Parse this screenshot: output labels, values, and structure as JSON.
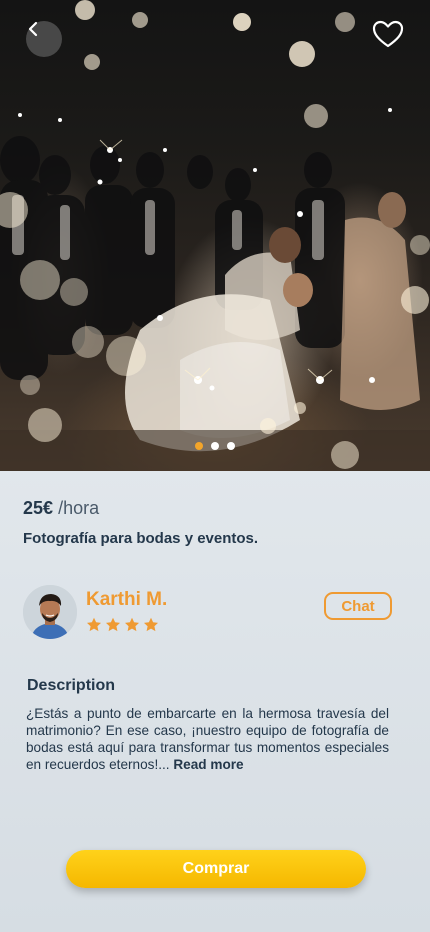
{
  "hero": {
    "icons": {
      "back": "chevron-left-icon",
      "favorite": "heart-outline-icon"
    },
    "carousel": {
      "count": 3,
      "active_index": 0
    }
  },
  "listing": {
    "price_amount": "25€",
    "price_unit": "/hora",
    "title": "Fotografía para bodas y eventos."
  },
  "provider": {
    "name": "Karthi M.",
    "rating_stars": 4,
    "chat_label": "Chat"
  },
  "description": {
    "heading": "Description",
    "text": "¿Estás a punto de embarcarte en la hermosa travesía del matrimonio? En ese caso, ¡nuestro equipo de fotografía de bodas está aquí para transformar tus momentos especiales en recuerdos eternos!... ",
    "read_more": "Read more"
  },
  "actions": {
    "buy_label": "Comprar"
  },
  "colors": {
    "accent": "#ef9a32",
    "button": "#f5b700",
    "text": "#24384b",
    "dot_active": "#f3a52a"
  }
}
